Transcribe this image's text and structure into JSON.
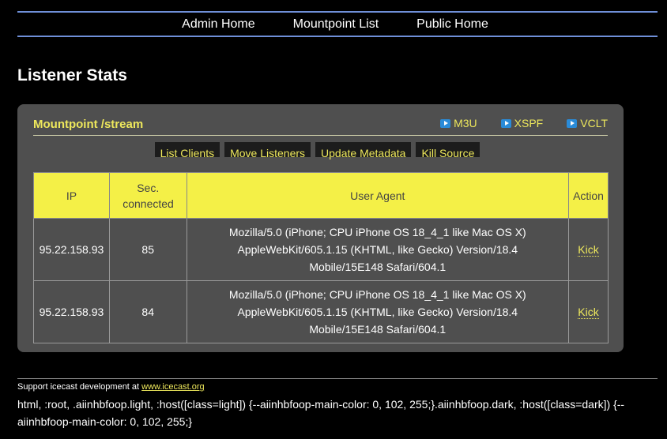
{
  "nav": {
    "items": [
      "Admin Home",
      "Mountpoint List",
      "Public Home"
    ]
  },
  "page_title": "Listener Stats",
  "mountpoint": {
    "title": "Mountpoint /stream",
    "playlist_links": [
      "M3U",
      "XSPF",
      "VCLT"
    ],
    "buttons": [
      "List Clients",
      "Move Listeners",
      "Update Metadata",
      "Kill Source"
    ]
  },
  "table": {
    "headers": [
      "IP",
      "Sec. connected",
      "User Agent",
      "Action"
    ],
    "rows": [
      {
        "ip": "95.22.158.93",
        "sec": "85",
        "agent": "Mozilla/5.0 (iPhone; CPU iPhone OS 18_4_1 like Mac OS X) AppleWebKit/605.1.15 (KHTML, like Gecko) Version/18.4 Mobile/15E148 Safari/604.1",
        "action": "Kick"
      },
      {
        "ip": "95.22.158.93",
        "sec": "84",
        "agent": "Mozilla/5.0 (iPhone; CPU iPhone OS 18_4_1 like Mac OS X) AppleWebKit/605.1.15 (KHTML, like Gecko) Version/18.4 Mobile/15E148 Safari/604.1",
        "action": "Kick"
      }
    ]
  },
  "footer": {
    "support_text": "Support icecast development at",
    "support_link": "www.icecast.org",
    "css_leak": "html, :root, .aiinhbfoop.light, :host([class=light]) {--aiinhbfoop-main-color: 0, 102, 255;}.aiinhbfoop.dark, :host([class=dark]) {--aiinhbfoop-main-color: 0, 102, 255;}"
  },
  "colors": {
    "accent_yellow": "#eee85c",
    "header_yellow": "#f4f047",
    "panel_grey": "#4f4f4f",
    "nav_rule_blue": "#6f8fd8"
  }
}
